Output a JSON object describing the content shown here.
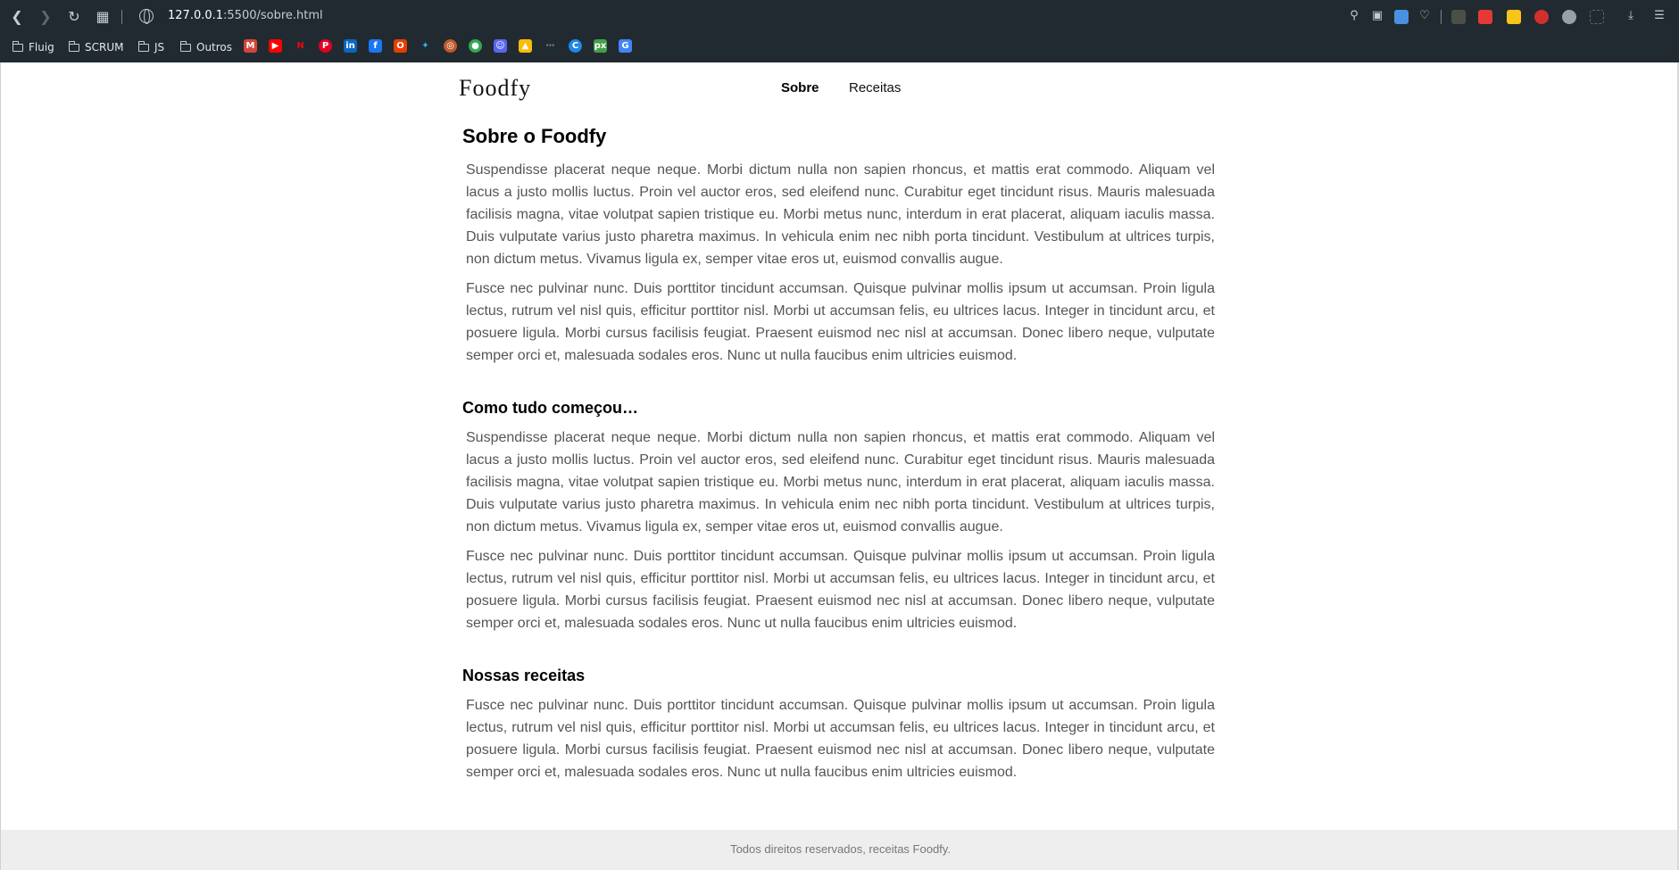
{
  "browser": {
    "url_host": "127.0.0.1",
    "url_rest": ":5500/sobre.html",
    "bookmarks": {
      "fluig": "Fluig",
      "scrum": "SCRUM",
      "js": "JS",
      "outros": "Outros"
    }
  },
  "site": {
    "logo": "Foodfy",
    "nav": {
      "sobre": "Sobre",
      "receitas": "Receitas"
    }
  },
  "main": {
    "title": "Sobre o Foodfy",
    "intro_p1": "Suspendisse placerat neque neque. Morbi dictum nulla non sapien rhoncus, et mattis erat commodo. Aliquam vel lacus a justo mollis luctus. Proin vel auctor eros, sed eleifend nunc. Curabitur eget tincidunt risus. Mauris malesuada facilisis magna, vitae volutpat sapien tristique eu. Morbi metus nunc, interdum in erat placerat, aliquam iaculis massa. Duis vulputate varius justo pharetra maximus. In vehicula enim nec nibh porta tincidunt. Vestibulum at ultrices turpis, non dictum metus. Vivamus ligula ex, semper vitae eros ut, euismod convallis augue.",
    "intro_p2": "Fusce nec pulvinar nunc. Duis porttitor tincidunt accumsan. Quisque pulvinar mollis ipsum ut accumsan. Proin ligula lectus, rutrum vel nisl quis, efficitur porttitor nisl. Morbi ut accumsan felis, eu ultrices lacus. Integer in tincidunt arcu, et posuere ligula. Morbi cursus facilisis feugiat. Praesent euismod nec nisl at accumsan. Donec libero neque, vulputate semper orci et, malesuada sodales eros. Nunc ut nulla faucibus enim ultricies euismod.",
    "section2_title": "Como tudo começou…",
    "section2_p1": "Suspendisse placerat neque neque. Morbi dictum nulla non sapien rhoncus, et mattis erat commodo. Aliquam vel lacus a justo mollis luctus. Proin vel auctor eros, sed eleifend nunc. Curabitur eget tincidunt risus. Mauris malesuada facilisis magna, vitae volutpat sapien tristique eu. Morbi metus nunc, interdum in erat placerat, aliquam iaculis massa. Duis vulputate varius justo pharetra maximus. In vehicula enim nec nibh porta tincidunt. Vestibulum at ultrices turpis, non dictum metus. Vivamus ligula ex, semper vitae eros ut, euismod convallis augue.",
    "section2_p2": "Fusce nec pulvinar nunc. Duis porttitor tincidunt accumsan. Quisque pulvinar mollis ipsum ut accumsan. Proin ligula lectus, rutrum vel nisl quis, efficitur porttitor nisl. Morbi ut accumsan felis, eu ultrices lacus. Integer in tincidunt arcu, et posuere ligula. Morbi cursus facilisis feugiat. Praesent euismod nec nisl at accumsan. Donec libero neque, vulputate semper orci et, malesuada sodales eros. Nunc ut nulla faucibus enim ultricies euismod.",
    "section3_title": "Nossas receitas",
    "section3_p1": "Fusce nec pulvinar nunc. Duis porttitor tincidunt accumsan. Quisque pulvinar mollis ipsum ut accumsan. Proin ligula lectus, rutrum vel nisl quis, efficitur porttitor nisl. Morbi ut accumsan felis, eu ultrices lacus. Integer in tincidunt arcu, et posuere ligula. Morbi cursus facilisis feugiat. Praesent euismod nec nisl at accumsan. Donec libero neque, vulputate semper orci et, malesuada sodales eros. Nunc ut nulla faucibus enim ultricies euismod."
  },
  "footer": {
    "text": "Todos direitos reservados, receitas Foodfy."
  },
  "colors": {
    "chrome_bg": "#212a31",
    "text_body": "#555555",
    "footer_bg": "#eeeeee"
  }
}
